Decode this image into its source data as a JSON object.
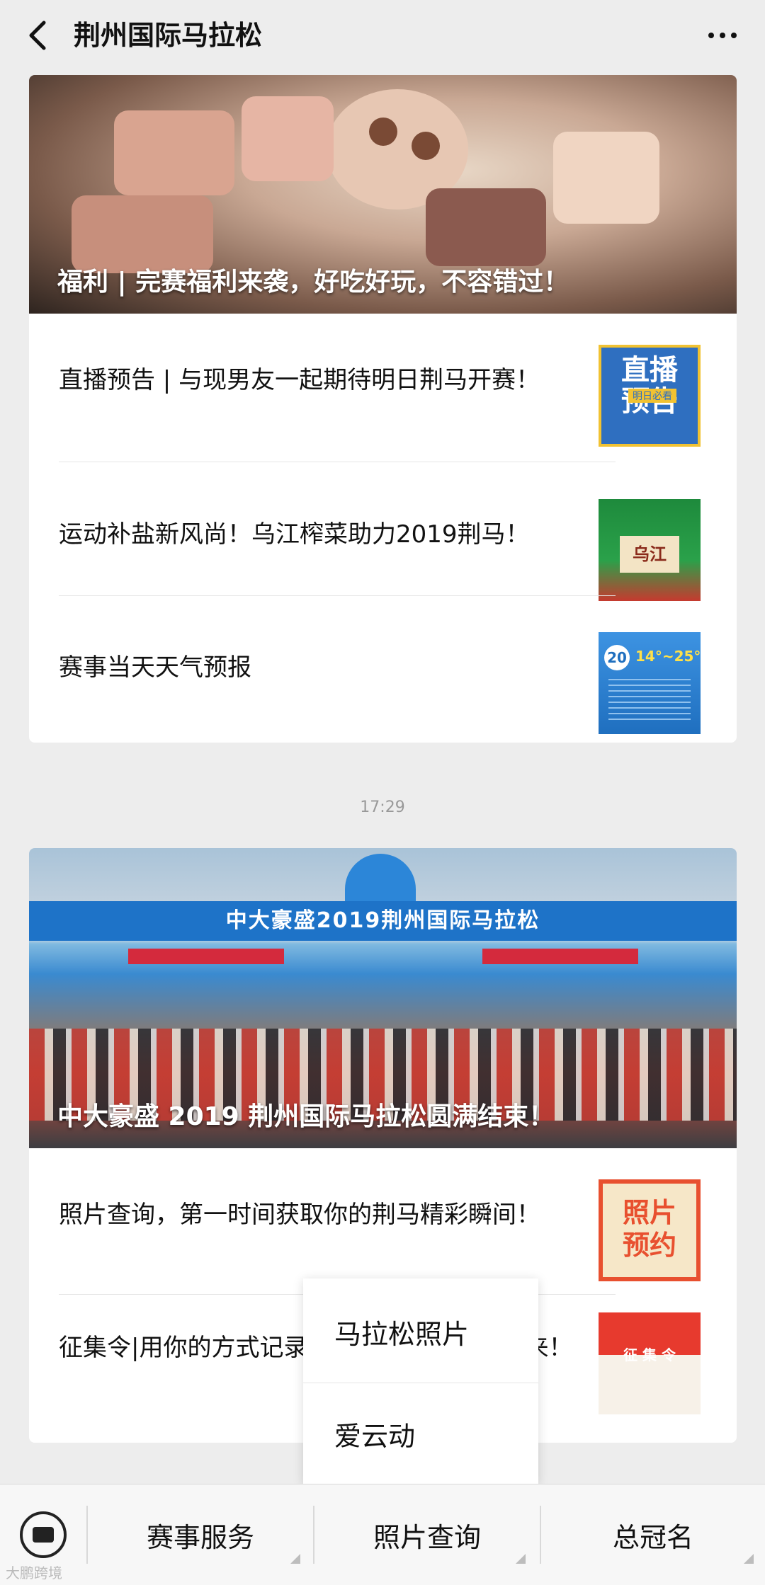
{
  "header": {
    "title": "荆州国际马拉松",
    "back_icon": "chevron-left-icon",
    "more_icon": "more-dots-icon"
  },
  "messages": [
    {
      "cover_title": "福利 | 完赛福利来袭，好吃好玩，不容错过！",
      "articles": [
        {
          "title": "直播预告 | 与现男友一起期待明日荆马开赛！",
          "thumb_text": "直播\n预告",
          "thumb_sub": "明日必看"
        },
        {
          "title": "运动补盐新风尚！乌江榨菜助力2019荆马！",
          "thumb_text": "乌江"
        },
        {
          "title": "赛事当天天气预报",
          "thumb_text": "20",
          "thumb_sub": "14°~25°"
        }
      ]
    },
    {
      "time": "17:29",
      "cover_title": "中大豪盛 2019 荆州国际马拉松圆满结束！",
      "banner": "中大豪盛2019荆州国际马拉松",
      "articles": [
        {
          "title": "照片查询，第一时间获取你的荆马精彩瞬间！",
          "thumb_text": "照片\n预约"
        },
        {
          "title": "征集令|用你的方式记录……频道推荐位等你来！",
          "thumb_text": "征 集 令"
        }
      ]
    }
  ],
  "popup_menu": {
    "items": [
      "马拉松照片",
      "爱云动"
    ]
  },
  "bottom_menu": {
    "keyboard_icon": "keyboard-icon",
    "tabs": [
      "赛事服务",
      "照片查询",
      "总冠名"
    ]
  },
  "watermark": "大鹏跨境"
}
